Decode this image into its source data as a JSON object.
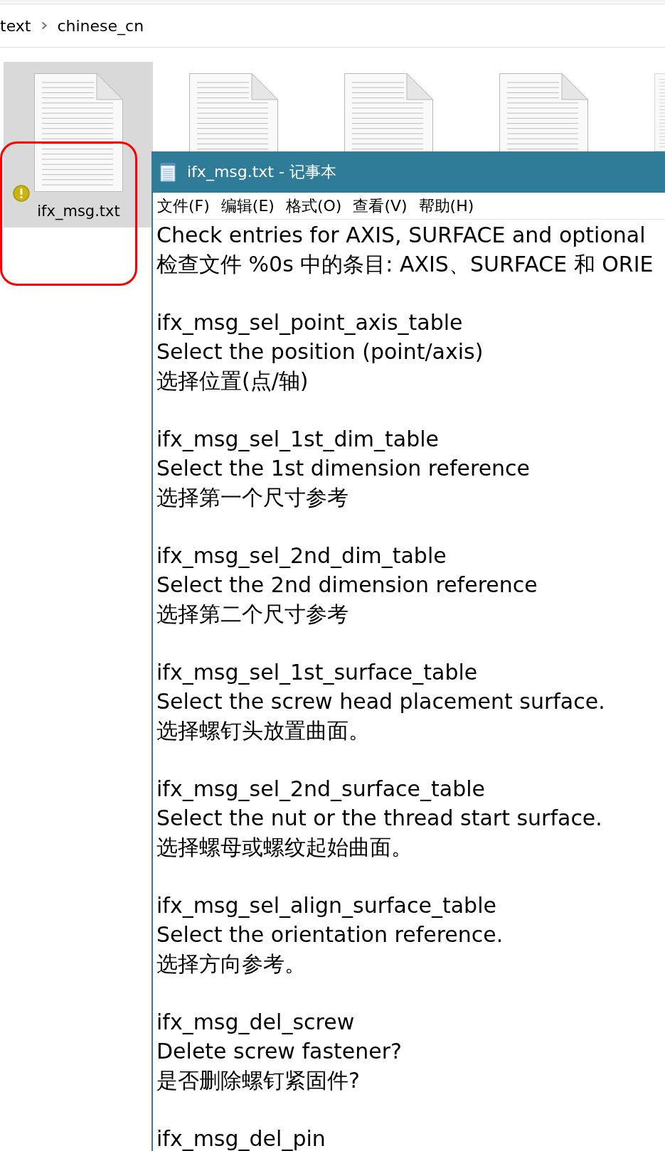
{
  "explorer": {
    "breadcrumb": [
      "text",
      "chinese_cn"
    ],
    "files": [
      {
        "name": "ifx_msg.txt",
        "selected": true,
        "warning": true
      },
      {
        "selected": false,
        "warning": false
      },
      {
        "selected": false,
        "warning": false
      },
      {
        "selected": false,
        "warning": false
      },
      {
        "selected": false,
        "warning": false
      }
    ]
  },
  "notepad": {
    "title": "ifx_msg.txt - 记事本",
    "menu": [
      "文件(F)",
      "编辑(E)",
      "格式(O)",
      "查看(V)",
      "帮助(H)"
    ],
    "entries": [
      {
        "lines": [
          "Check entries for AXIS, SURFACE and optional",
          "检查文件 %0s 中的条目: AXIS、SURFACE 和 ORIE"
        ]
      },
      {
        "lines": [
          "ifx_msg_sel_point_axis_table",
          "Select the position (point/axis)",
          "选择位置(点/轴)"
        ]
      },
      {
        "lines": [
          "ifx_msg_sel_1st_dim_table",
          "Select the 1st dimension reference",
          "选择第一个尺寸参考"
        ]
      },
      {
        "lines": [
          "ifx_msg_sel_2nd_dim_table",
          "Select the 2nd dimension reference",
          "选择第二个尺寸参考"
        ]
      },
      {
        "lines": [
          "ifx_msg_sel_1st_surface_table",
          "Select the screw head placement surface.",
          "选择螺钉头放置曲面。"
        ]
      },
      {
        "lines": [
          "ifx_msg_sel_2nd_surface_table",
          "Select the nut or the thread start surface.",
          "选择螺母或螺纹起始曲面。"
        ]
      },
      {
        "lines": [
          "ifx_msg_sel_align_surface_table",
          "Select the orientation reference.",
          "选择方向参考。"
        ]
      },
      {
        "lines": [
          "ifx_msg_del_screw",
          "Delete screw fastener?",
          "是否删除螺钉紧固件?"
        ]
      },
      {
        "lines": [
          "ifx_msg_del_pin"
        ]
      }
    ]
  }
}
